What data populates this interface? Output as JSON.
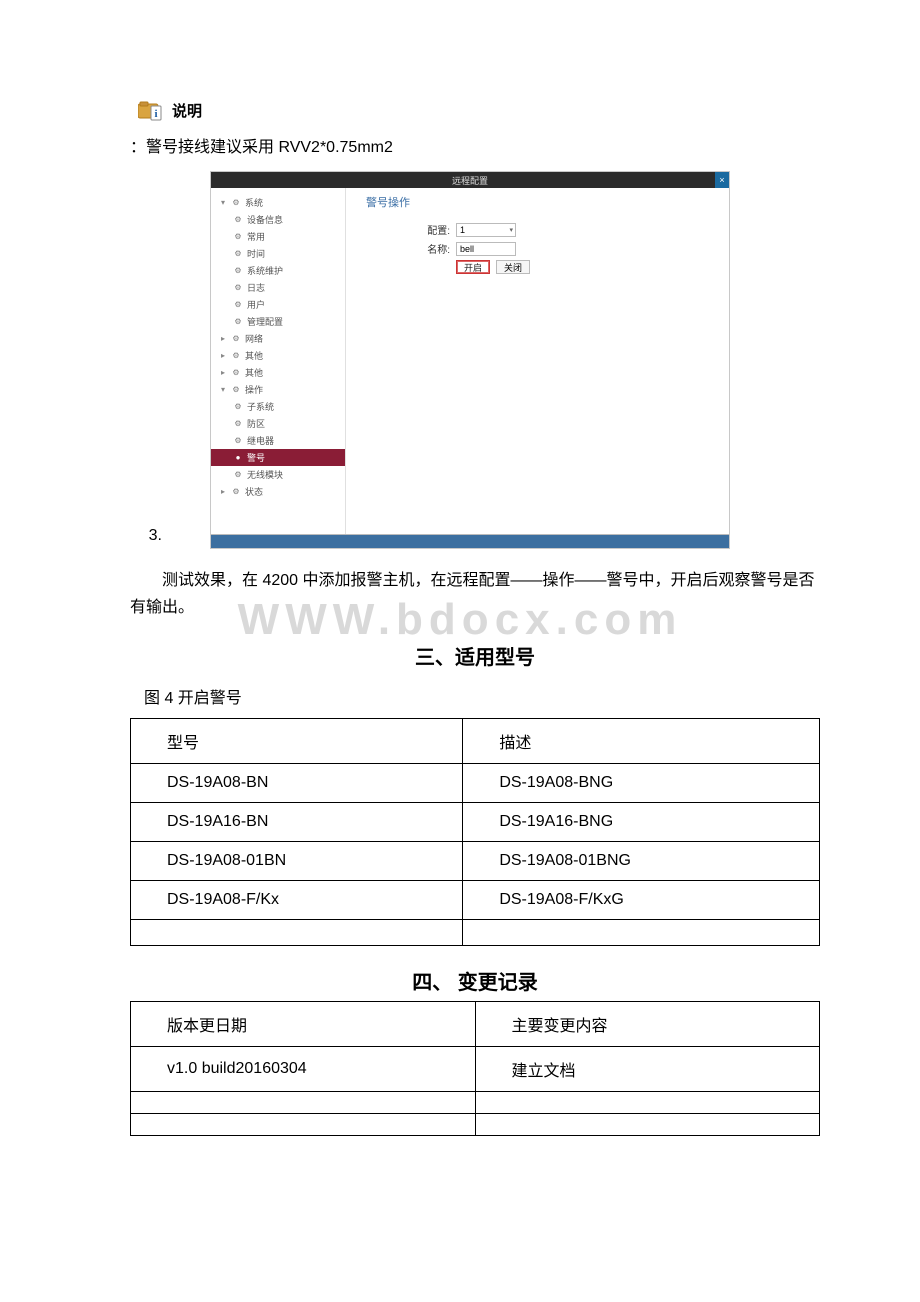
{
  "watermark": "WWW.bdocx.com",
  "callout": {
    "label": "说明"
  },
  "note_text": "：警号接线建议采用 RVV2*0.75mm2",
  "shot": {
    "number_prefix": "3.",
    "titlebar": "远程配置",
    "sub_title": "警号操作",
    "form": {
      "row1_label": "配置:",
      "row1_value": "1",
      "row2_label": "名称:",
      "row2_value": "bell",
      "btn_primary": "开启",
      "btn_secondary": "关闭"
    },
    "tree": {
      "groups": [
        {
          "label": "系统",
          "open": true,
          "children": [
            {
              "label": "设备信息"
            },
            {
              "label": "常用"
            },
            {
              "label": "时间"
            },
            {
              "label": "系统维护"
            },
            {
              "label": "日志"
            },
            {
              "label": "用户"
            },
            {
              "label": "管理配置"
            }
          ]
        },
        {
          "label": "网络",
          "open": false,
          "children": []
        },
        {
          "label": "其他",
          "open": false,
          "children": []
        },
        {
          "label": "其他",
          "open": false,
          "children": []
        },
        {
          "label": "操作",
          "open": true,
          "children": [
            {
              "label": "子系统"
            },
            {
              "label": "防区"
            },
            {
              "label": "继电器"
            },
            {
              "label": "警号",
              "selected": true
            },
            {
              "label": "无线模块"
            }
          ]
        },
        {
          "label": "状态",
          "open": false,
          "children": []
        }
      ]
    }
  },
  "test_paragraph": "测试效果，在 4200 中添加报警主机，在远程配置——操作——警号中，开启后观察警号是否有输出。",
  "section3_title": "三、适用型号",
  "figure4_caption": "图 4 开启警号",
  "models_table": {
    "headers": [
      "型号",
      "描述"
    ],
    "rows": [
      [
        "DS-19A08-BN",
        "DS-19A08-BNG"
      ],
      [
        "DS-19A16-BN",
        "DS-19A16-BNG"
      ],
      [
        "DS-19A08-01BN",
        "DS-19A08-01BNG"
      ],
      [
        "DS-19A08-F/Kx",
        "DS-19A08-F/KxG"
      ]
    ]
  },
  "section4_title": "四、 变更记录",
  "changes_table": {
    "headers": [
      "版本更日期",
      "主要变更内容"
    ],
    "rows": [
      [
        "v1.0 build20160304",
        "建立文档"
      ]
    ]
  }
}
